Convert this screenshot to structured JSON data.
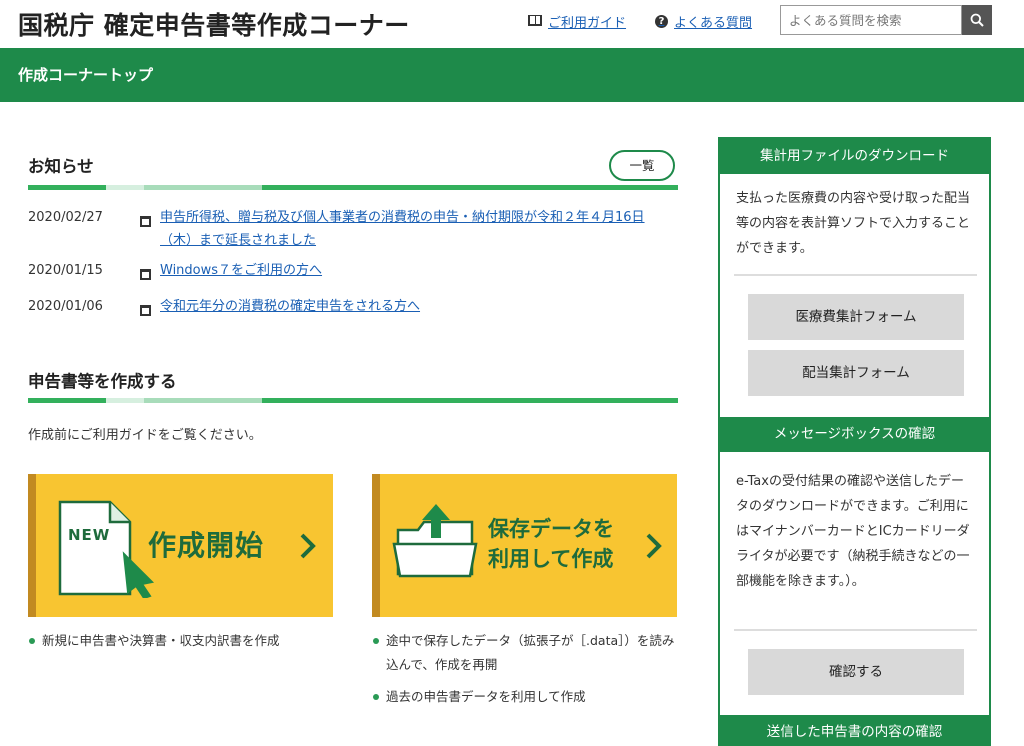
{
  "header": {
    "title": "国税庁 確定申告書等作成コーナー",
    "guide_link": "ご利用ガイド",
    "faq_link": "よくある質問",
    "search_placeholder": "よくある質問を検索"
  },
  "nav": {
    "title": "作成コーナートップ"
  },
  "news": {
    "title": "お知らせ",
    "more_label": "一覧",
    "items": [
      {
        "date": "2020/02/27",
        "text": "申告所得税、贈与税及び個人事業者の消費税の申告・納付期限が令和２年４月16日（木）まで延長されました"
      },
      {
        "date": "2020/01/15",
        "text": "Windows７をご利用の方へ"
      },
      {
        "date": "2020/01/06",
        "text": "令和元年分の消費税の確定申告をされる方へ"
      }
    ]
  },
  "create": {
    "title": "申告書等を作成する",
    "intro": "作成前にご利用ガイドをご覧ください。",
    "new_badge": "NEW",
    "new_card_label": "作成開始",
    "load_card_label_line1": "保存データを",
    "load_card_label_line2": "利用して作成",
    "new_bullets": [
      "新規に申告書や決算書・収支内訳書を作成"
    ],
    "load_bullets": [
      "途中で保存したデータ（拡張子が［.data］）を読み込んで、作成を再開",
      "過去の申告書データを利用して作成"
    ]
  },
  "sidebar": {
    "download": {
      "title": "集計用ファイルのダウンロード",
      "text": "支払った医療費の内容や受け取った配当等の内容を表計算ソフトで入力することができます。",
      "btn_medical": "医療費集計フォーム",
      "btn_dividend": "配当集計フォーム"
    },
    "messagebox": {
      "title": "メッセージボックスの確認",
      "text": "e-Taxの受付結果の確認や送信したデータのダウンロードができます。ご利用にはマイナンバーカードとICカードリーダライタが必要です（納税手続きなどの一部機能を除きます。）。",
      "btn": "確認する"
    },
    "sent": {
      "title": "送信した申告書の内容の確認"
    }
  },
  "colors": {
    "brand_green": "#1e8a4a",
    "card_yellow": "#f8c531",
    "link_blue": "#1a5fb4"
  }
}
